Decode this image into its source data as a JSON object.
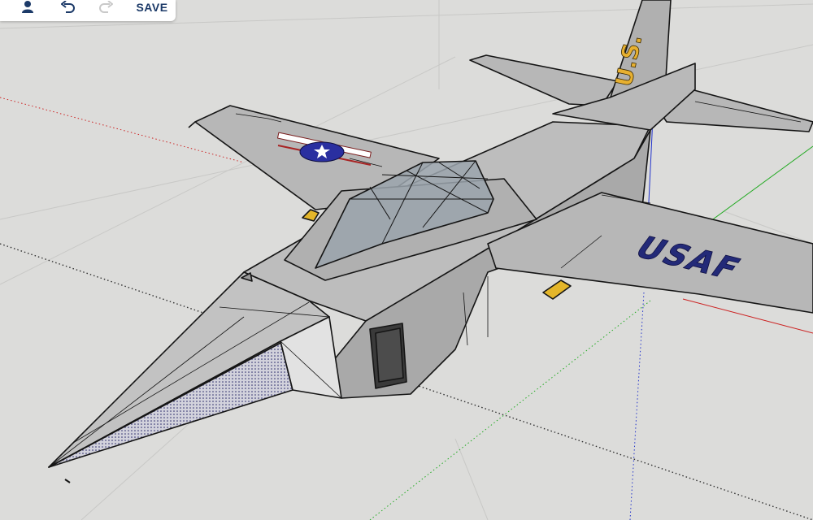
{
  "toolbar": {
    "save_label": "SAVE",
    "icons": {
      "user": "user-icon",
      "undo": "undo-icon",
      "redo": "redo-icon"
    }
  },
  "model": {
    "tail_marking": "U.S.",
    "wing_marking": "USAF",
    "roundel": "star-insignia"
  },
  "colors": {
    "background": "#dcdcda",
    "fuselage": "#b3b3b3",
    "toolbar_text": "#1c3a68",
    "axis_red": "#cc2222",
    "axis_green": "#22aa22",
    "axis_blue": "#2233cc",
    "usaf_text": "#232a78",
    "tail_text": "#e7b030"
  }
}
